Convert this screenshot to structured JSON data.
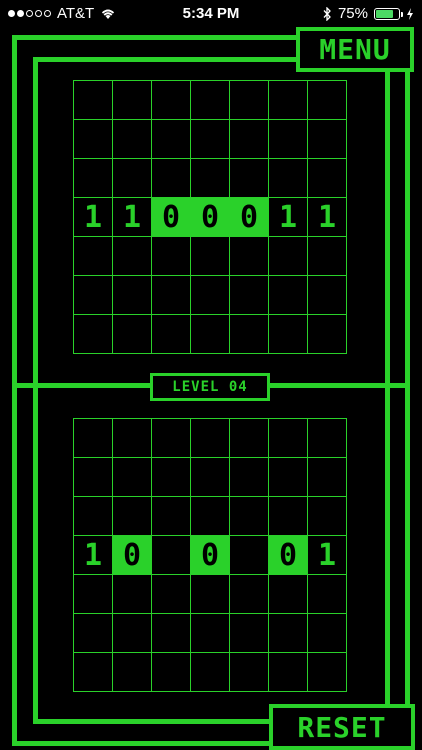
{
  "status_bar": {
    "carrier": "AT&T",
    "time": "5:34 PM",
    "battery_percent": "75%",
    "battery_level": 0.75,
    "signal_bars_filled": 2,
    "signal_bars_total": 5
  },
  "menu_label": "MENU",
  "reset_label": "RESET",
  "level_label": "LEVEL 04",
  "colors": {
    "accent": "#2ad12a",
    "background": "#000000"
  },
  "target_row": [
    "1",
    "1",
    "0",
    "0",
    "0",
    "1",
    "1"
  ],
  "target_row_filled": [
    false,
    false,
    true,
    true,
    true,
    false,
    false
  ],
  "player_row": [
    "1",
    "0",
    "",
    "0",
    "",
    "0",
    "1"
  ],
  "player_row_filled": [
    false,
    true,
    false,
    true,
    false,
    true,
    false
  ]
}
